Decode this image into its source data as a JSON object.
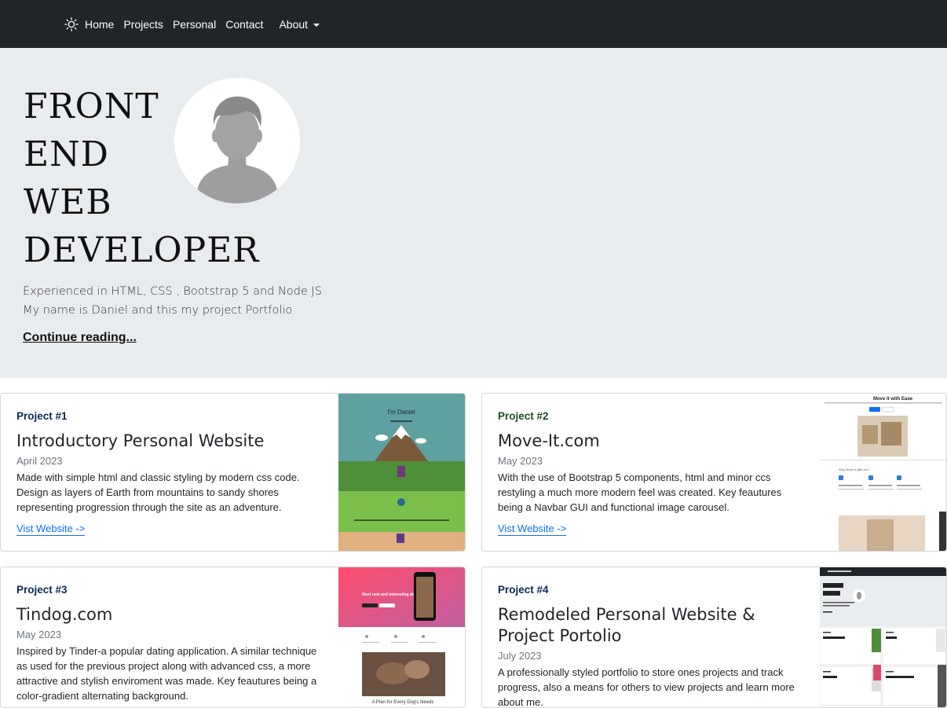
{
  "nav": {
    "brand_icon": "sun-icon",
    "links": [
      "Home",
      "Projects",
      "Personal",
      "Contact"
    ],
    "dropdown_label": "About"
  },
  "hero": {
    "title": "FRONT\nEND\nWEB\nDEVELOPER",
    "lead_line1": "Experienced in HTML, CSS , Bootstrap 5 and Node JS",
    "lead_line2": "My name is Daniel and this my project Portfolio",
    "link": "Continue reading..."
  },
  "cards": [
    {
      "tag": "Project #1",
      "title": "Introductory Personal Website",
      "date": "April 2023",
      "text": "Made with simple html and classic styling by modern css code. Design as layers of Earth from mountains to sandy shores representing progression through the site as an adventure.",
      "link": "Vist Website ->",
      "thumb": {
        "heading": "I'm Daniel"
      }
    },
    {
      "tag": "Project #2",
      "title": "Move-It.com",
      "date": "May 2023",
      "text": "With the use of Bootstrap 5 components, html and minor ccs restyling a much more modern feel was created. Key feautures being a Navbar GUI and functional image carousel.",
      "link": "Vist Website ->",
      "thumb": {
        "heading": "Move It with Ease"
      }
    },
    {
      "tag": "Project #3",
      "title": "Tindog.com",
      "date": "May 2023",
      "text": "Inspired by Tinder-a popular dating application. A similar technique as used for the previous project along with advanced css, a more attractive and stylish enviroment was made. Key feautures being a color-gradient alternating background.",
      "link": "",
      "thumb": {
        "heading": "Meet new and interesting dogs nearby.",
        "caption": "A Plan for Every Dog's Needs"
      }
    },
    {
      "tag": "Project #4",
      "title": "Remodeled Personal Website & Project Portolio",
      "date": "July 2023",
      "text": "A professionally styled portfolio to store ones projects and track progress, also a means for others to view projects and learn more about me.",
      "link": "",
      "thumb": {}
    }
  ]
}
